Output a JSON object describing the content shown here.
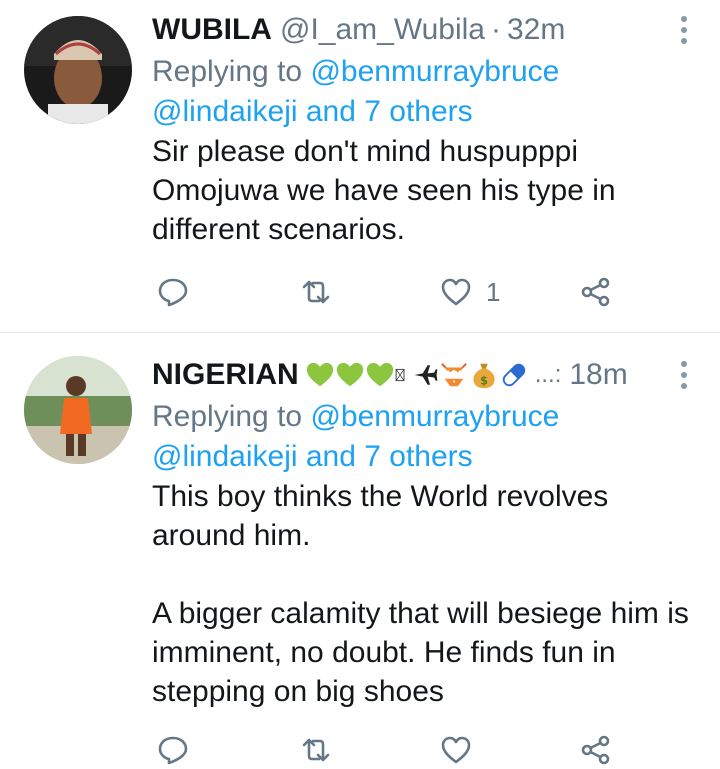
{
  "tweets": [
    {
      "name": "WUBILA",
      "handle": "@I_am_Wubila",
      "separator": "·",
      "time": "32m",
      "replying_prefix": "Replying to",
      "replying_user": "@benmurraybruce",
      "replying_rest": "@lindaikeji and 7 others",
      "text": "Sir please don't mind huspupppi\nOmojuwa we have seen his type in\ndifferent scenarios.",
      "like_count": "1",
      "avatar_desc": "man-with-cap"
    },
    {
      "name": "NIGERIAN",
      "name_suffix": "...:",
      "time": "18m",
      "replying_prefix": "Replying to",
      "replying_user": "@benmurraybruce",
      "replying_rest": "@lindaikeji and 7 others",
      "text": "This boy thinks the World revolves\naround him.\n\nA bigger calamity that will besiege him is\nimminent, no doubt. He finds fun in\nstepping on big shoes",
      "like_count": "",
      "name_emojis": [
        "green-heart-icon",
        "green-heart-icon",
        "green-heart-icon",
        "unknown-glyph-icon",
        "airplane-icon",
        "bikini-icon",
        "money-bag-icon",
        "pill-icon"
      ]
    }
  ],
  "colors": {
    "link": "#1da1f2",
    "secondary": "#657786",
    "separator": "#e1e8ed",
    "icon": "#657786"
  }
}
